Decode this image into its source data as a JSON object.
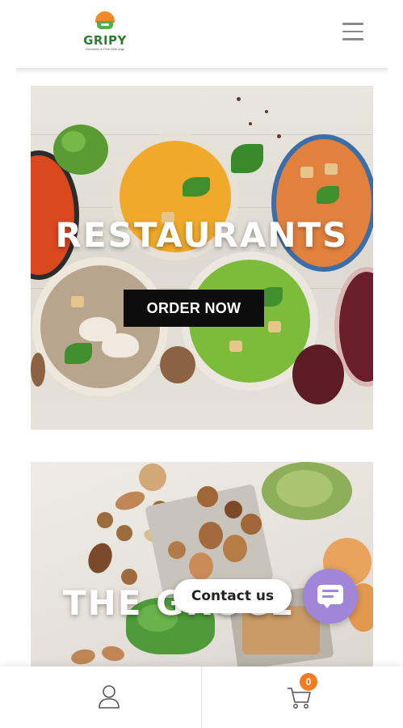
{
  "header": {
    "logo_text": "GRIPY",
    "logo_tagline": "Groceries & Fine Dine-ings",
    "menu_icon": "hamburger-menu-icon"
  },
  "banners": [
    {
      "title": "RESTAURANTS",
      "button_label": "ORDER NOW"
    },
    {
      "title": "THE GROCE"
    }
  ],
  "contact": {
    "label": "Contact us",
    "icon": "chat-bubble-icon",
    "accent": "#a085d8"
  },
  "bottom_nav": {
    "account_icon": "user-icon",
    "cart_icon": "cart-icon",
    "cart_count": "0",
    "badge_color": "#f07b20"
  }
}
